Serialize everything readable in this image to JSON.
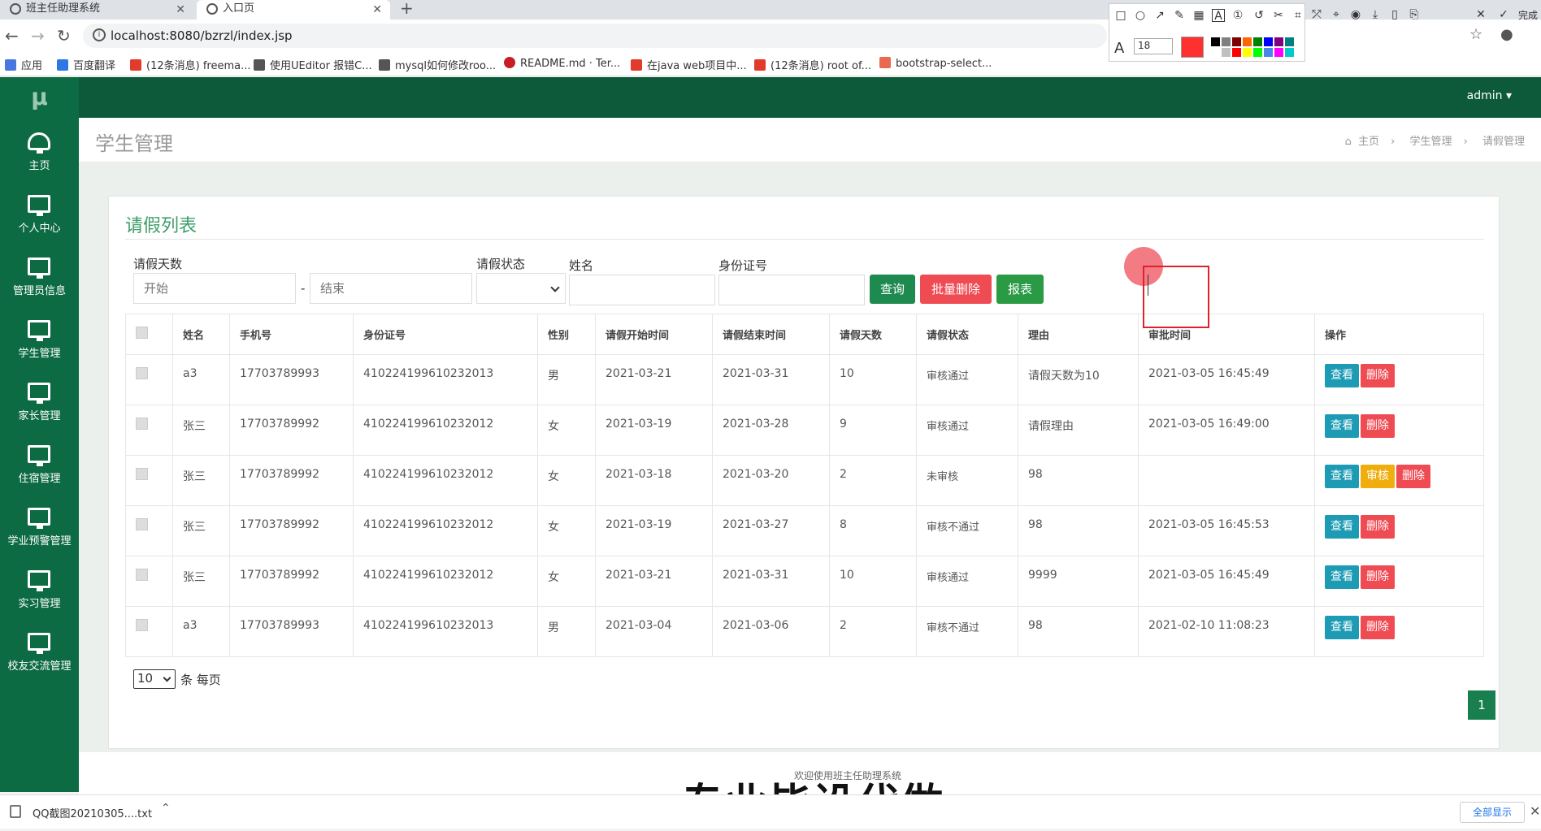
{
  "browser": {
    "tabs": [
      {
        "label": "班主任助理系统",
        "active": false
      },
      {
        "label": "入口页",
        "active": true
      }
    ],
    "new_tab": "+",
    "url": "localhost:8080/bzrzl/index.jsp",
    "bookmarks": [
      {
        "label": "应用",
        "icon": "apps-grid-icon",
        "color": "#4a76e0"
      },
      {
        "label": "百度翻译",
        "icon": "baidu-translate-icon",
        "color": "#2e77e5"
      },
      {
        "label": "(12条消息) freema...",
        "icon": "csdn-icon",
        "color": "#e33b2b"
      },
      {
        "label": "使用UEditor 报错C...",
        "icon": "bookmark-icon",
        "color": "#555555"
      },
      {
        "label": "mysql如何修改roo...",
        "icon": "bookmark-icon",
        "color": "#555555"
      },
      {
        "label": "README.md · Ter...",
        "icon": "gitee-icon",
        "color": "#c71d23"
      },
      {
        "label": "在java web项目中...",
        "icon": "csdn-icon",
        "color": "#e33b2b"
      },
      {
        "label": "(12条消息) root of...",
        "icon": "csdn-icon",
        "color": "#e33b2b"
      },
      {
        "label": "bootstrap-select...",
        "icon": "jianshu-icon",
        "color": "#e9694f"
      }
    ]
  },
  "screenshot_tool": {
    "font_size": "18",
    "current_color": "#ff3030",
    "done_label": "完成",
    "palette": [
      "#000000",
      "#808080",
      "#800000",
      "#ff6600",
      "#008000",
      "#0000ff",
      "#800080",
      "#008080",
      "#ffffff",
      "#c0c0c0",
      "#ff0000",
      "#ffff00",
      "#00ff00",
      "#4a86e8",
      "#ff00ff",
      "#00cccc"
    ]
  },
  "app": {
    "logo": "μ",
    "admin_label": "admin",
    "sidebar": [
      {
        "label": "主页",
        "icon": "dashboard-icon"
      },
      {
        "label": "个人中心",
        "icon": "monitor-icon"
      },
      {
        "label": "管理员信息",
        "icon": "monitor-icon"
      },
      {
        "label": "学生管理",
        "icon": "monitor-icon"
      },
      {
        "label": "家长管理",
        "icon": "monitor-icon"
      },
      {
        "label": "住宿管理",
        "icon": "monitor-icon"
      },
      {
        "label": "学业预警管理",
        "icon": "monitor-icon"
      },
      {
        "label": "实习管理",
        "icon": "monitor-icon"
      },
      {
        "label": "校友交流管理",
        "icon": "monitor-icon"
      }
    ],
    "page_title": "学生管理",
    "breadcrumb": [
      "主页",
      "学生管理",
      "请假管理"
    ],
    "breadcrumb_sep": "›",
    "panel_title": "请假列表",
    "filters": {
      "days_label": "请假天数",
      "start_placeholder": "开始",
      "dash": "-",
      "end_placeholder": "结束",
      "status_label": "请假状态",
      "name_label": "姓名",
      "idcard_label": "身份证号",
      "query_button": "查询",
      "batch_delete_button": "批量删除",
      "report_button": "报表"
    },
    "table": {
      "headers": [
        "姓名",
        "手机号",
        "身份证号",
        "性别",
        "请假开始时间",
        "请假结束时间",
        "请假天数",
        "请假状态",
        "理由",
        "审批时间",
        "操作"
      ],
      "rows": [
        {
          "name": "a3",
          "phone": "17703789993",
          "idcard": "410224199610232013",
          "gender": "男",
          "start": "2021-03-21",
          "end": "2021-03-31",
          "days": "10",
          "status": "审核通过",
          "reason": "请假天数为10",
          "approved": "2021-03-05 16:45:49",
          "audit": false
        },
        {
          "name": "张三",
          "phone": "17703789992",
          "idcard": "410224199610232012",
          "gender": "女",
          "start": "2021-03-19",
          "end": "2021-03-28",
          "days": "9",
          "status": "审核通过",
          "reason": "请假理由",
          "approved": "2021-03-05 16:49:00",
          "audit": false
        },
        {
          "name": "张三",
          "phone": "17703789992",
          "idcard": "410224199610232012",
          "gender": "女",
          "start": "2021-03-18",
          "end": "2021-03-20",
          "days": "2",
          "status": "未审核",
          "reason": "98",
          "approved": "",
          "audit": true
        },
        {
          "name": "张三",
          "phone": "17703789992",
          "idcard": "410224199610232012",
          "gender": "女",
          "start": "2021-03-19",
          "end": "2021-03-27",
          "days": "8",
          "status": "审核不通过",
          "reason": "98",
          "approved": "2021-03-05 16:45:53",
          "audit": false
        },
        {
          "name": "张三",
          "phone": "17703789992",
          "idcard": "410224199610232012",
          "gender": "女",
          "start": "2021-03-21",
          "end": "2021-03-31",
          "days": "10",
          "status": "审核通过",
          "reason": "9999",
          "approved": "2021-03-05 16:45:49",
          "audit": false
        },
        {
          "name": "a3",
          "phone": "17703789993",
          "idcard": "410224199610232013",
          "gender": "男",
          "start": "2021-03-04",
          "end": "2021-03-06",
          "days": "2",
          "status": "审核不通过",
          "reason": "98",
          "approved": "2021-02-10 11:08:23",
          "audit": false
        }
      ],
      "view_label": "查看",
      "audit_label": "审核",
      "delete_label": "删除"
    },
    "pagination": {
      "per_page_value": "10",
      "per_page_suffix": "条 每页",
      "current_page": "1"
    },
    "footer_text": "欢迎使用班主任助理系统",
    "watermark": "专业毕设代做"
  },
  "download_bar": {
    "file_name": "QQ截图20210305....txt",
    "show_all": "全部显示"
  },
  "colors": {
    "sidebar": "#0d6b43",
    "topbar": "#0d5a3b",
    "accent_green": "#3e9e6a",
    "btn_query": "#1f8a4f",
    "btn_delete": "#ef4b53",
    "btn_report": "#2a9a45"
  }
}
